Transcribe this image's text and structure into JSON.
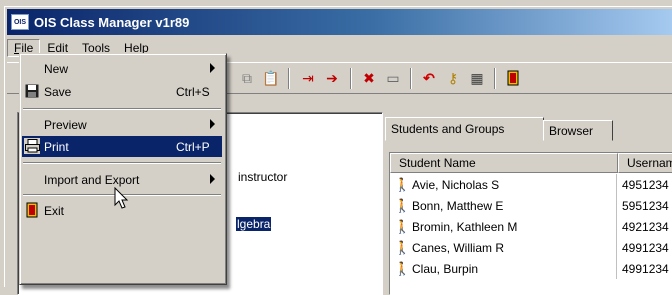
{
  "window": {
    "title": "OIS Class Manager v1r89",
    "app_icon_text": "OIS"
  },
  "menubar": {
    "items": [
      "File",
      "Edit",
      "Tools",
      "Help"
    ]
  },
  "file_menu": {
    "items": [
      {
        "label": "New",
        "submenu": true
      },
      {
        "label": "Save",
        "shortcut": "Ctrl+S",
        "icon": "save-icon"
      },
      {
        "label": "Preview",
        "submenu": true
      },
      {
        "label": "Print",
        "shortcut": "Ctrl+P",
        "icon": "printer-icon",
        "highlighted": true
      },
      {
        "label": "Import and Export",
        "submenu": true
      },
      {
        "label": "Exit",
        "icon": "exit-door-icon"
      }
    ]
  },
  "tree": {
    "item_instructor": "instructor",
    "item_selected": "lgebra"
  },
  "tabs": [
    "Students and Groups",
    "Browser"
  ],
  "grid": {
    "columns": [
      "Student Name",
      "Usernam"
    ],
    "rows": [
      {
        "name": "Avie, Nicholas S",
        "username": "4951234"
      },
      {
        "name": "Bonn, Matthew E",
        "username": "5951234"
      },
      {
        "name": "Bromin, Kathleen M",
        "username": "4921234"
      },
      {
        "name": "Canes, William R",
        "username": "4991234"
      },
      {
        "name": "Clau, Burpin",
        "username": "4991234"
      }
    ]
  },
  "colors": {
    "title_start": "#0a246a",
    "title_end": "#a6caf0",
    "highlight": "#0a246a",
    "face": "#d4d0c8"
  }
}
